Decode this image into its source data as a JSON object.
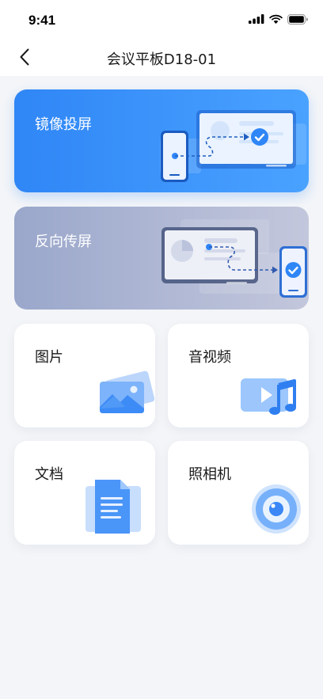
{
  "status_bar": {
    "time": "9:41",
    "icons": [
      "signal-icon",
      "wifi-icon",
      "battery-icon"
    ]
  },
  "nav": {
    "back_icon": "chevron-left-icon",
    "title": "会议平板D18-01"
  },
  "features": {
    "mirror_label": "镜像投屏",
    "reverse_label": "反向传屏"
  },
  "tiles": {
    "photo_label": "图片",
    "av_label": "音视频",
    "doc_label": "文档",
    "camera_label": "照相机"
  },
  "colors": {
    "accent": "#2f86f6",
    "mirror_gradient": [
      "#2f86f6",
      "#4aa2ff"
    ],
    "reverse_gradient": [
      "#9aa7cb",
      "#c3c7dc"
    ],
    "background": "#f3f5f8"
  }
}
